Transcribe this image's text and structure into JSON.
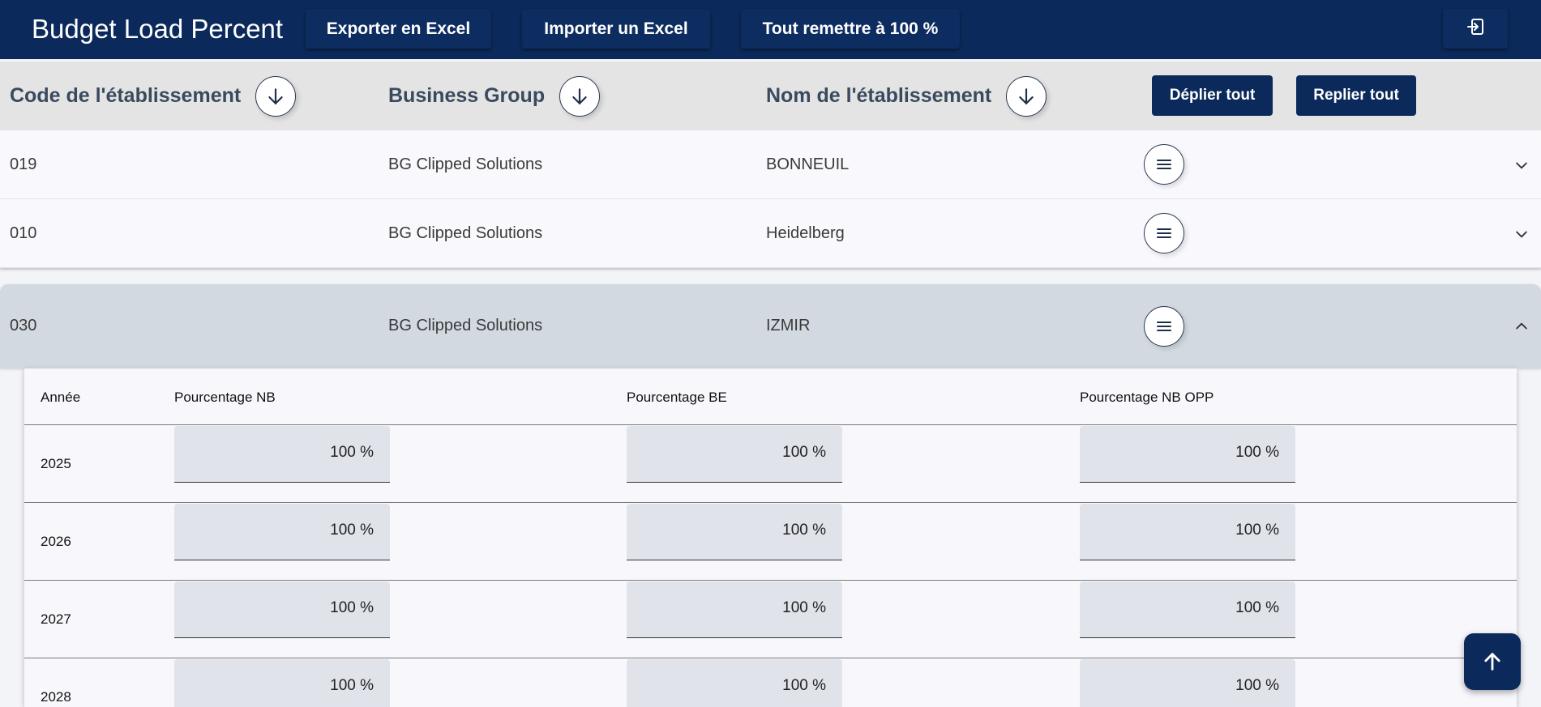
{
  "app": {
    "title": "Budget Load Percent"
  },
  "toolbar": {
    "export_label": "Exporter en Excel",
    "import_label": "Importer un Excel",
    "reset_label": "Tout remettre à 100 %",
    "logout_icon": "logout-icon"
  },
  "header": {
    "code_label": "Code de l'établissement",
    "bg_label": "Business Group",
    "name_label": "Nom de l'établissement",
    "expand_all_label": "Déplier tout",
    "collapse_all_label": "Replier tout"
  },
  "rows": [
    {
      "code": "019",
      "business_group": "BG Clipped Solutions",
      "name": "BONNEUIL",
      "expanded": false
    },
    {
      "code": "010",
      "business_group": "BG Clipped Solutions",
      "name": "Heidelberg",
      "expanded": false
    },
    {
      "code": "030",
      "business_group": "BG Clipped Solutions",
      "name": "IZMIR",
      "expanded": true
    }
  ],
  "detail": {
    "columns": [
      "Année",
      "Pourcentage NB",
      "Pourcentage BE",
      "Pourcentage NB OPP"
    ],
    "years": [
      {
        "year": "2025",
        "nb": "100 %",
        "be": "100 %",
        "nb_opp": "100 %"
      },
      {
        "year": "2026",
        "nb": "100 %",
        "be": "100 %",
        "nb_opp": "100 %"
      },
      {
        "year": "2027",
        "nb": "100 %",
        "be": "100 %",
        "nb_opp": "100 %"
      },
      {
        "year": "2028",
        "nb": "100 %",
        "be": "100 %",
        "nb_opp": "100 %"
      }
    ]
  },
  "colors": {
    "primary": "#0b2a5b",
    "header_bg": "#e4e4e4",
    "expanded_row_bg": "#d3d9e1",
    "input_bg": "#e1e3ea"
  }
}
